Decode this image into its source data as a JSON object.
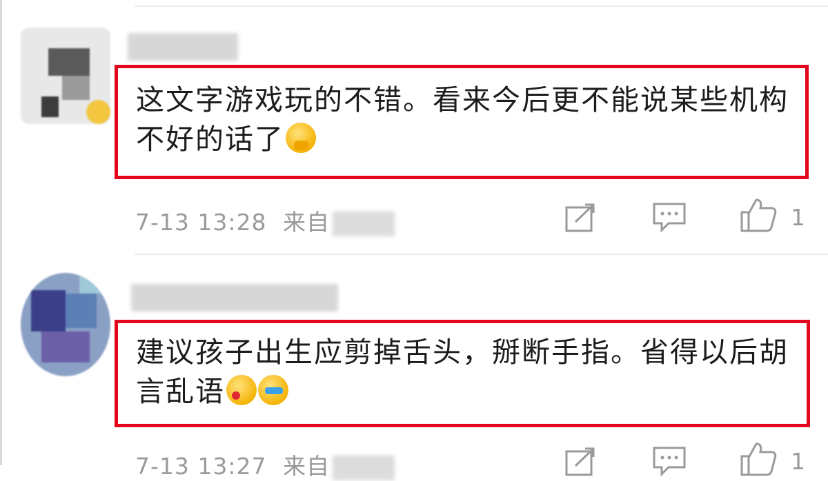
{
  "comments": [
    {
      "text": "这文字游戏玩的不错。看来今后更不能说某些机构不好的话了",
      "emoji": "thinking-face-emoji",
      "timestamp": "7-13 13:28",
      "source_prefix": "来自",
      "like_count": "1"
    },
    {
      "text": "建议孩子出生应剪掉舌头，掰断手指。省得以后胡言乱语",
      "emoji": [
        "kiss-face-emoji",
        "laughing-face-emoji"
      ],
      "timestamp": "7-13 13:27",
      "source_prefix": "来自",
      "like_count": "1"
    }
  ],
  "icons": {
    "share": "share-icon",
    "comment": "comment-icon",
    "like": "like-thumb-icon"
  },
  "colors": {
    "highlight_border": "#e3061c",
    "meta_text": "#9a9a9a"
  }
}
